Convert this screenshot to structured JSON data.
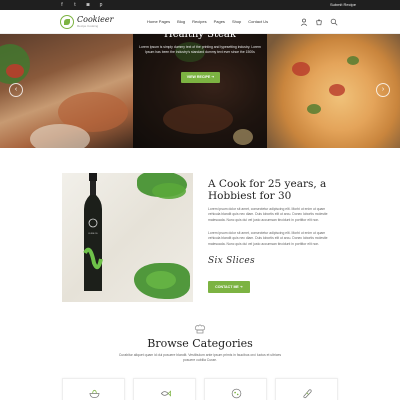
{
  "topbar": {
    "social_icons": [
      "facebook-icon",
      "twitter-icon",
      "instagram-icon",
      "pinterest-icon"
    ],
    "social_glyphs": [
      "f",
      "t",
      "◙",
      "p"
    ],
    "submit_recipe": "Submit Recipe"
  },
  "header": {
    "logo_name": "Cookieer",
    "logo_tagline": "Recipe Cooking",
    "nav": [
      "Home Pages",
      "Blog",
      "Recipes",
      "Pages",
      "Shop",
      "Contact Us"
    ],
    "icons": [
      "user-icon",
      "cart-icon",
      "search-icon"
    ]
  },
  "hero": {
    "title": "Healthy Steak",
    "text": "Lorem Ipsum is simply dummy text of the printing and typesetting industry. Lorem Ipsum has been the industry's standard dummy text ever since the 1500s",
    "button": "VIEW RECIPE  ➜",
    "prev_arrow": "‹",
    "next_arrow": "›"
  },
  "about": {
    "title": "A Cook for 25 years, a Hobbiest for 30",
    "para1": "Lorem ipsum dolor sit amet, consectetur adipiscing elit. Morbi ut enim ut quam vehicula blandit quis nec diam. Duis lobortis elit ut arcu. Donec lobortis molestie malesuada. Nunc quis dui vel justo accumsan tincidunt in porttitor elit non.",
    "para2": "Lorem ipsum dolor sit amet, consectetur adipiscing elit. Morbi ut enim ut quam vehicula blandit quis nec diam. Duis lobortis elit ut arcu. Donec lobortis molestie malesuada. Nunc quis dui vel justo accumsan tincidunt in porttitor elit non.",
    "signature": "Six Slices",
    "button": "CONTACT ME  ➜",
    "bottle_label": "OLIVE OIL"
  },
  "categories": {
    "title": "Browse Categories",
    "subtitle": "Curabitur aliquet quam id dui posuere blandit. Vestibulum ante ipsum primis in faucibus orci luctus et ultrices posuere cubilia Curae.",
    "cards": [
      "salad-icon",
      "fish-icon",
      "pizza-icon",
      "bread-icon"
    ]
  },
  "colors": {
    "accent": "#7cb342",
    "topbar": "#1f1f1f",
    "heading": "#222222"
  }
}
